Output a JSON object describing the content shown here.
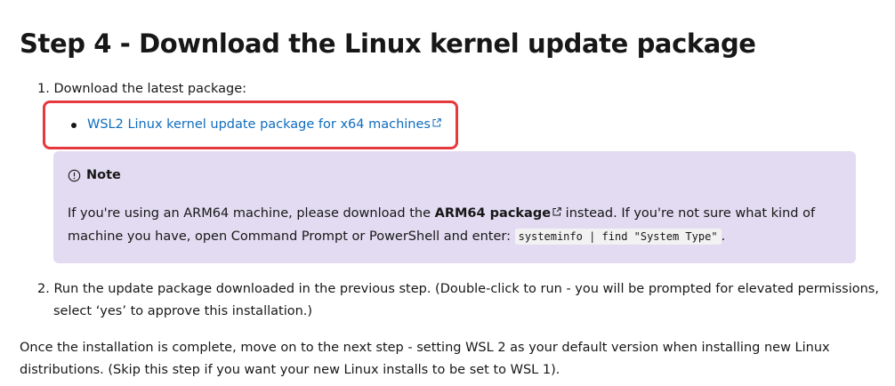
{
  "heading": "Step 4 - Download the Linux kernel update package",
  "steps": [
    {
      "number": "1.",
      "text": "Download the latest package:"
    },
    {
      "number": "2.",
      "line1": "Run the update package downloaded in the previous step. (Double-click to run - you will be prompted for elevated permissions,",
      "line2": "select ‘yes’ to approve this installation.)"
    }
  ],
  "download_link": "WSL2 Linux kernel update package for x64 machines",
  "note": {
    "title": "Note",
    "text_before_link": "If you're using an ARM64 machine, please download the ",
    "link": "ARM64 package",
    "text_after_link": " instead. If you're not sure what kind of machine you have, open Command Prompt or PowerShell and enter: ",
    "code": "systeminfo | find \"System Type\"",
    "text_end": "."
  },
  "paragraph": "Once the installation is complete, move on to the next step - setting WSL 2 as your default version when installing new Linux distributions. (Skip this step if you want your new Linux installs to be set to WSL 1).",
  "colors": {
    "link": "#0f6cbd",
    "note_bg": "#e2dbf1",
    "highlight": "#e5393e",
    "text": "#171717"
  }
}
